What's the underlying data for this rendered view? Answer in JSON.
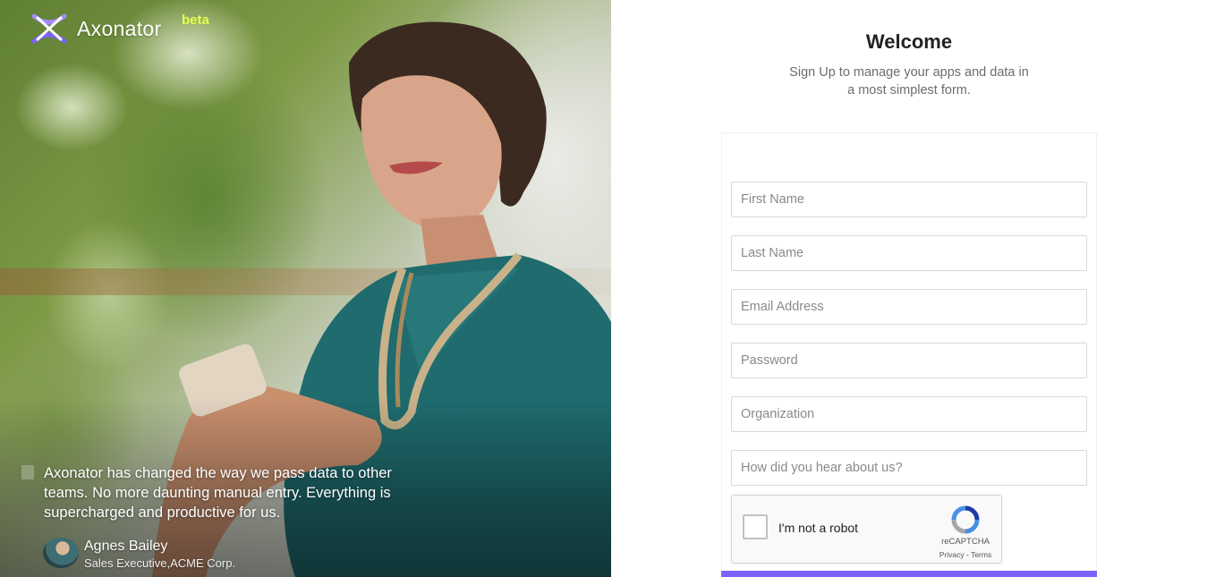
{
  "brand": {
    "name": "Axonator",
    "badge": "beta",
    "logo_icon": "axonator-x-logo-icon"
  },
  "hero": {
    "quote": "Axonator has changed the way we pass data to other teams. No more daunting manual entry. Everything is supercharged and productive for us.",
    "author_name": "Agnes Bailey",
    "author_title": "Sales Executive,ACME Corp."
  },
  "signup": {
    "title": "Welcome",
    "subtitle_line1": "Sign Up to manage your apps and data in",
    "subtitle_line2": "a most simplest form.",
    "fields": {
      "first_name": "First Name",
      "last_name": "Last Name",
      "email": "Email Address",
      "password": "Password",
      "organization": "Organization",
      "referral": "How did you hear about us?"
    }
  },
  "captcha": {
    "label": "I'm not a robot",
    "brand": "reCAPTCHA",
    "links": "Privacy - Terms"
  },
  "colors": {
    "accent": "#7b61ff",
    "beta": "#e6ff4a"
  }
}
